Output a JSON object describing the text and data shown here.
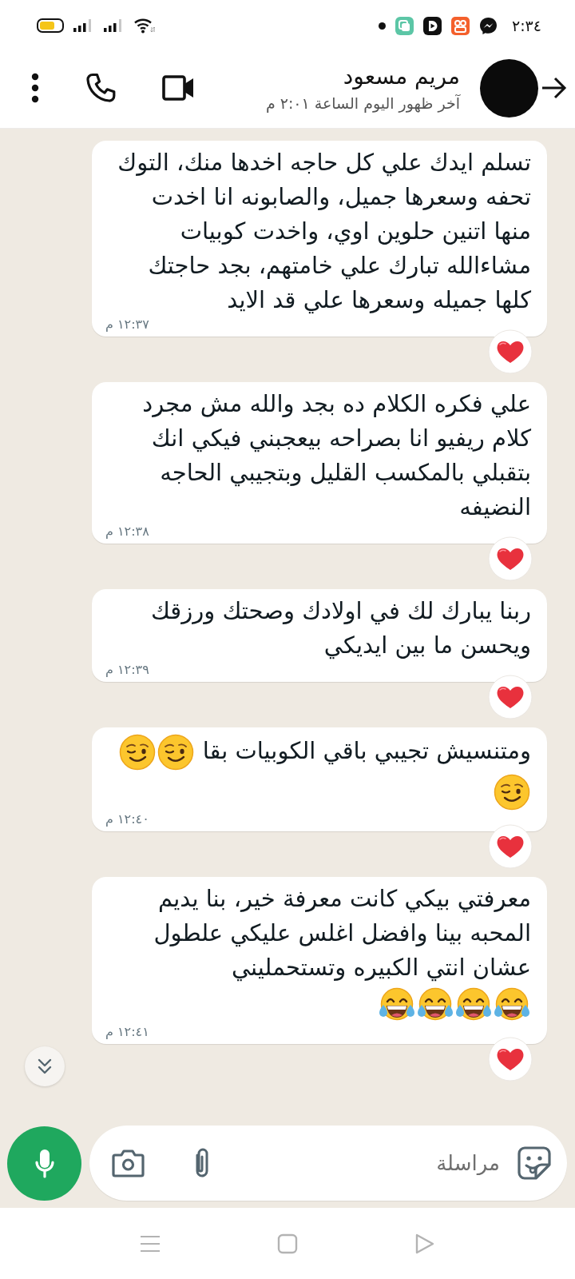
{
  "status_bar": {
    "time": "٢:٣٤"
  },
  "header": {
    "name": "مريم مسعود",
    "last_seen": "آخر ظهور اليوم الساعة ٢:٠١ م"
  },
  "messages": [
    {
      "text": "تسلم ايدك علي كل حاجه اخدها منك، التوك تحفه وسعرها جميل، والصابونه انا اخدت منها اتنين حلوين اوي، واخدت كوبيات مشاءالله تبارك علي خامتهم، بجد حاجتك كلها جميله وسعرها علي قد الايد",
      "time": "١٢:٣٧ م",
      "reacted": true
    },
    {
      "text": "علي فكره الكلام ده بجد والله مش مجرد كلام ريفيو انا بصراحه بيعجبني فيكي انك بتقبلي بالمكسب القليل وبتجيبي الحاجه النضيفه",
      "time": "١٢:٣٨ م",
      "reacted": true
    },
    {
      "text": "ربنا يبارك لك في اولادك وصحتك ورزقك ويحسن ما بين ايديكي",
      "time": "١٢:٣٩ م",
      "reacted": true
    },
    {
      "text": "ومتنسيش تجيبي باقي الكوبيات بقا",
      "emojis": [
        {
          "kind": "wink"
        },
        {
          "kind": "wink"
        },
        {
          "kind": "wink"
        }
      ],
      "time": "١٢:٤٠ م",
      "reacted": true
    },
    {
      "text": "معرفتي بيكي كانت معرفة خير، بنا يديم المحبه بينا وافضل اغلس عليكي علطول عشان انتي الكبيره وتستحمليني",
      "emojis": [
        {
          "kind": "laugh"
        },
        {
          "kind": "laugh"
        },
        {
          "kind": "laugh"
        },
        {
          "kind": "laugh"
        }
      ],
      "time": "١٢:٤١ م",
      "reacted": true
    }
  ],
  "composer": {
    "placeholder": "مراسلة"
  }
}
